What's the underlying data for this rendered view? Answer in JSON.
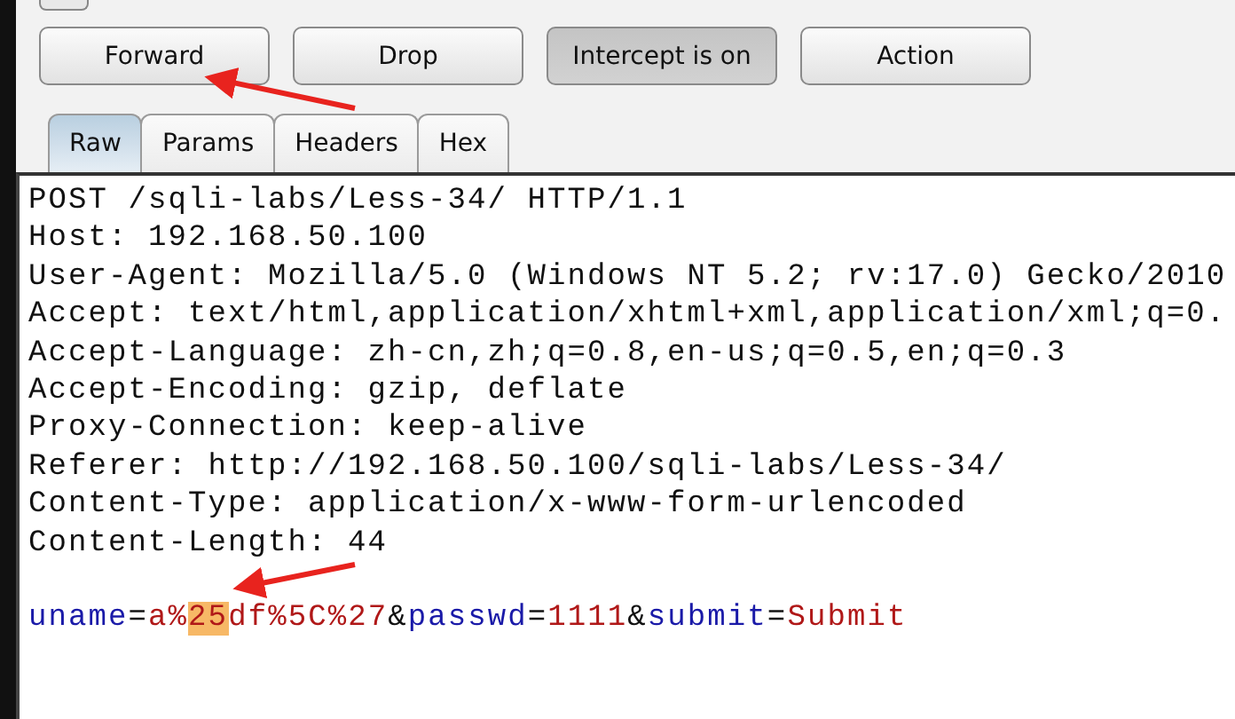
{
  "buttons": [
    {
      "label": "Forward",
      "pressed": false
    },
    {
      "label": "Drop",
      "pressed": false
    },
    {
      "label": "Intercept is on",
      "pressed": true
    },
    {
      "label": "Action",
      "pressed": false
    }
  ],
  "tabs": [
    {
      "label": "Raw",
      "selected": true
    },
    {
      "label": "Params",
      "selected": false
    },
    {
      "label": "Headers",
      "selected": false
    },
    {
      "label": "Hex",
      "selected": false
    }
  ],
  "request_lines": [
    "POST /sqli-labs/Less-34/ HTTP/1.1",
    "Host: 192.168.50.100",
    "User-Agent: Mozilla/5.0 (Windows NT 5.2; rv:17.0) Gecko/2010",
    "Accept: text/html,application/xhtml+xml,application/xml;q=0.",
    "Accept-Language: zh-cn,zh;q=0.8,en-us;q=0.5,en;q=0.3",
    "Accept-Encoding: gzip, deflate",
    "Proxy-Connection: keep-alive",
    "Referer: http://192.168.50.100/sqli-labs/Less-34/",
    "Content-Type: application/x-www-form-urlencoded",
    "Content-Length: 44"
  ],
  "body": [
    {
      "kind": "name",
      "text": "uname"
    },
    {
      "kind": "separator",
      "text": "="
    },
    {
      "kind": "value",
      "text": "a%",
      "highlighted": false
    },
    {
      "kind": "value",
      "text": "25",
      "highlighted": true
    },
    {
      "kind": "value",
      "text": "df%5C%27",
      "highlighted": false
    },
    {
      "kind": "separator",
      "text": "&"
    },
    {
      "kind": "name",
      "text": "passwd"
    },
    {
      "kind": "separator",
      "text": "="
    },
    {
      "kind": "value",
      "text": "1111",
      "highlighted": false
    },
    {
      "kind": "separator",
      "text": "&"
    },
    {
      "kind": "name",
      "text": "submit"
    },
    {
      "kind": "separator",
      "text": "="
    },
    {
      "kind": "value",
      "text": "Submit",
      "highlighted": false
    }
  ]
}
